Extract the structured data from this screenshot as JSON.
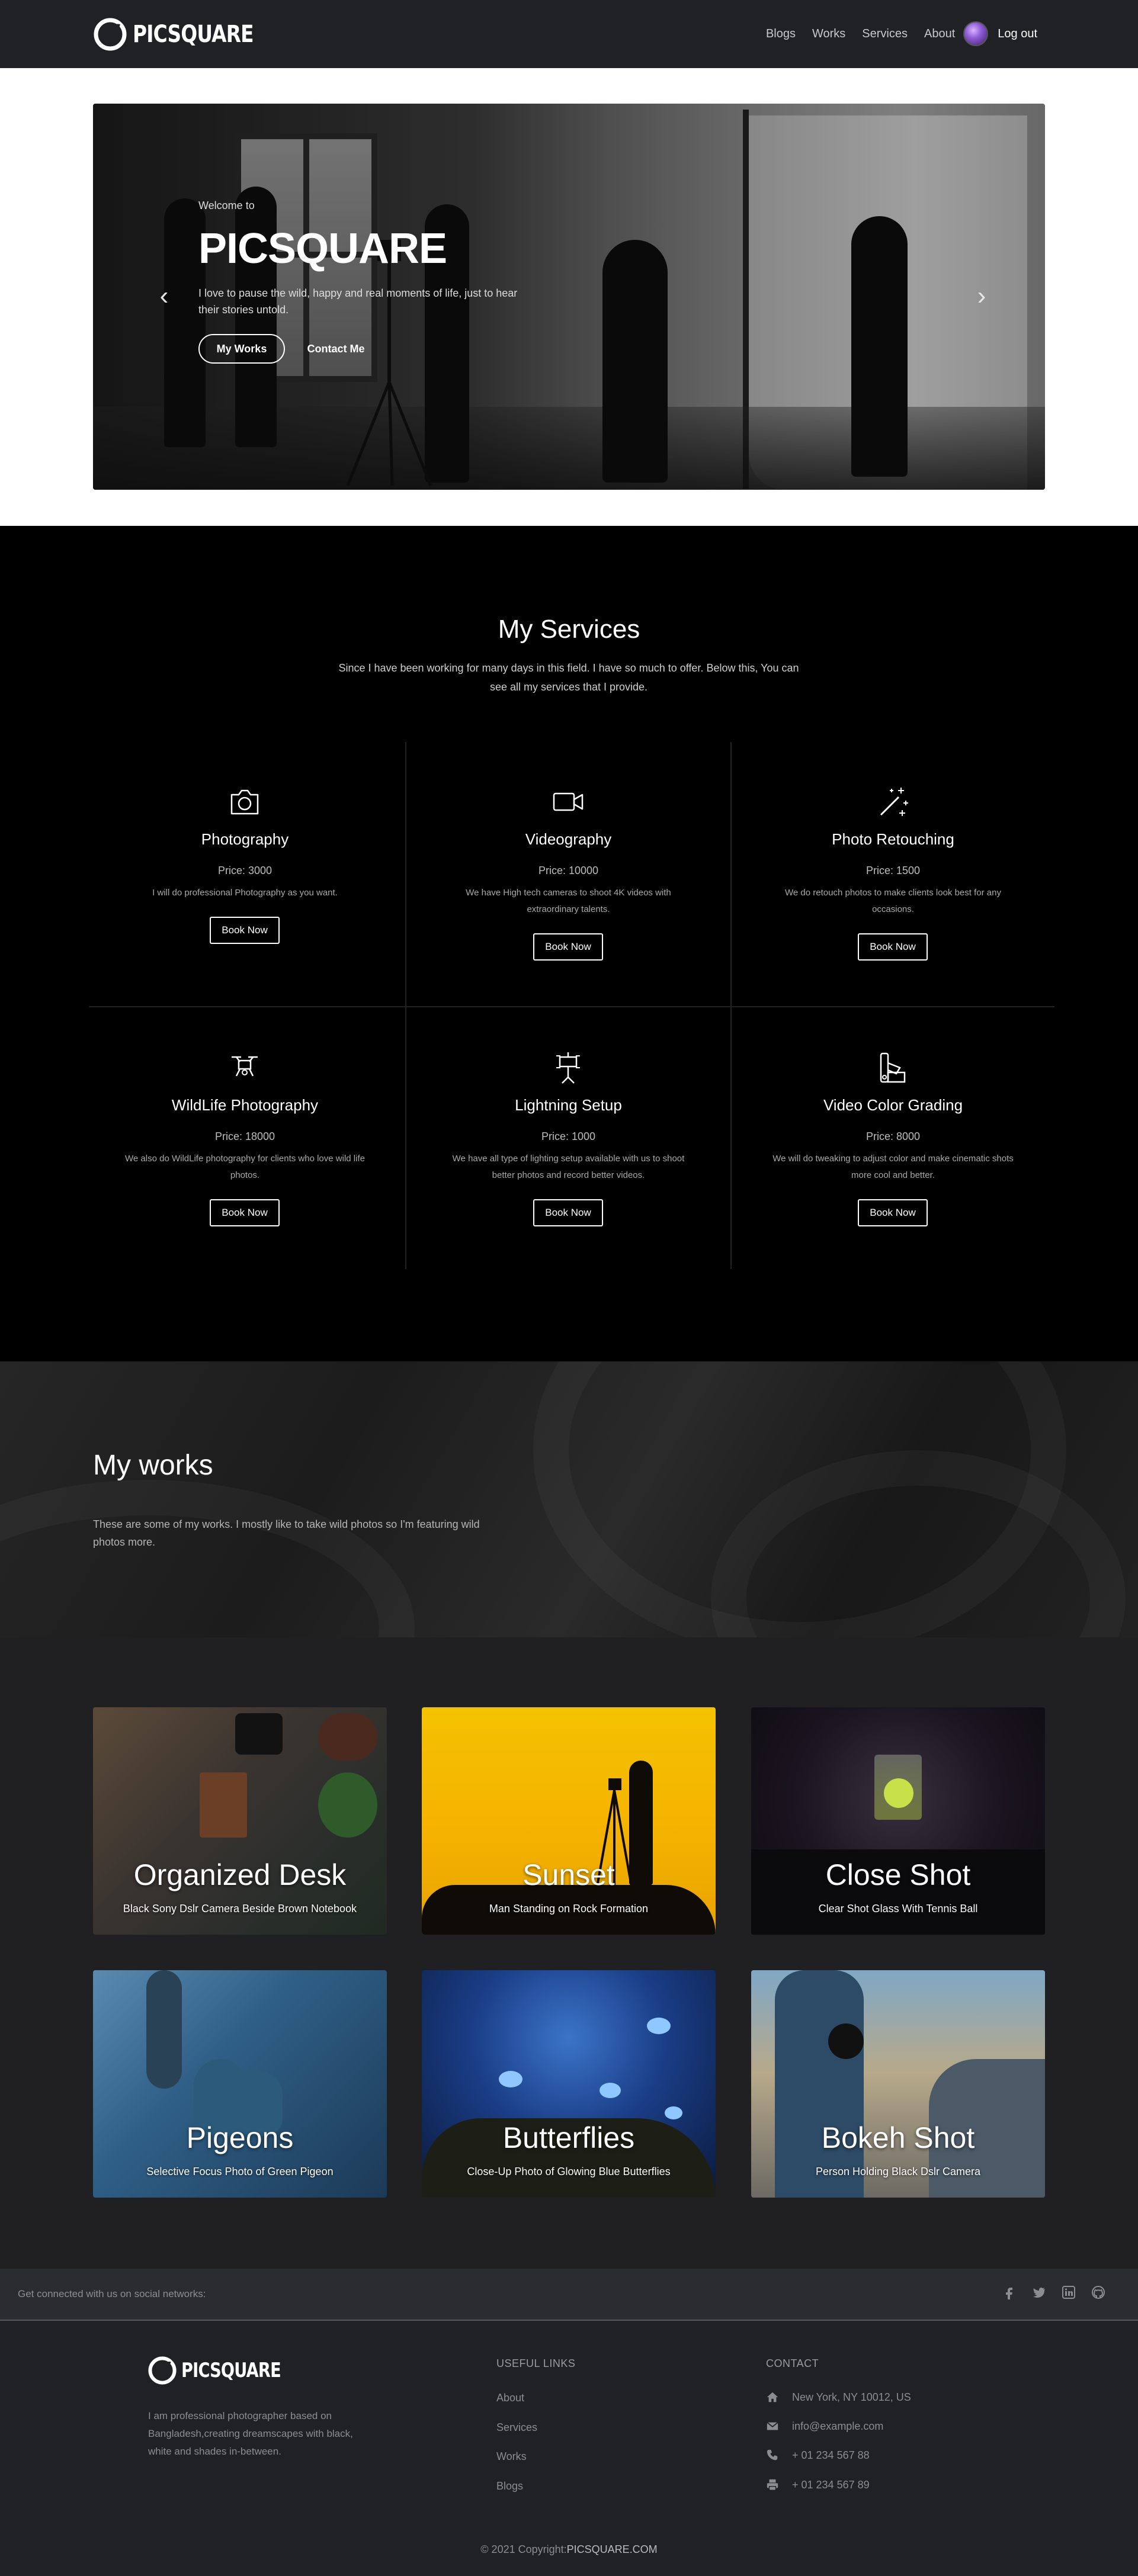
{
  "nav": {
    "brand": "PICSQUARE",
    "links": [
      "Blogs",
      "Works",
      "Services",
      "About"
    ],
    "logout": "Log out"
  },
  "hero": {
    "welcome": "Welcome to",
    "title": "PICSQUARE",
    "description": "I love to pause the wild, happy and real moments of life, just to hear their stories untold.",
    "primary_button": "My Works",
    "secondary_button": "Contact Me",
    "prev_icon": "chevron-left-icon",
    "next_icon": "chevron-right-icon"
  },
  "services": {
    "title": "My Services",
    "subtitle": "Since I have been working for many days in this field. I have so much to offer. Below this, You can see all my services that I provide.",
    "items": [
      {
        "name": "Photography",
        "price": "Price: 3000",
        "desc": "I will do professional Photography as you want.",
        "button": "Book Now",
        "icon": "camera-icon"
      },
      {
        "name": "Videography",
        "price": "Price: 10000",
        "desc": "We have High tech cameras to shoot 4K videos with extraordinary talents.",
        "button": "Book Now",
        "icon": "video-camera-icon"
      },
      {
        "name": "Photo Retouching",
        "price": "Price: 1500",
        "desc": "We do retouch photos to make clients look best for any occasions.",
        "button": "Book Now",
        "icon": "magic-wand-icon"
      },
      {
        "name": "WildLife Photography",
        "price": "Price: 18000",
        "desc": "We also do WildLife photography for clients who love wild life photos.",
        "button": "Book Now",
        "icon": "drone-icon"
      },
      {
        "name": "Lightning Setup",
        "price": "Price: 1000",
        "desc": "We have all type of lighting setup available with us to shoot better photos and record better videos.",
        "button": "Book Now",
        "icon": "studio-light-icon"
      },
      {
        "name": "Video Color Grading",
        "price": "Price: 8000",
        "desc": "We will do tweaking to adjust color and make cinematic shots more cool and better.",
        "button": "Book Now",
        "icon": "color-palette-icon"
      }
    ]
  },
  "works": {
    "title": "My works",
    "subtitle": "These are some of my works. I mostly like to take wild photos so I'm featuring wild photos more.",
    "cards": [
      {
        "title": "Organized Desk",
        "subtitle": "Black Sony Dslr Camera Beside Brown Notebook"
      },
      {
        "title": "Sunset",
        "subtitle": "Man Standing on Rock Formation"
      },
      {
        "title": "Close Shot",
        "subtitle": "Clear Shot Glass With Tennis Ball"
      },
      {
        "title": "Pigeons",
        "subtitle": "Selective Focus Photo of Green Pigeon"
      },
      {
        "title": "Butterflies",
        "subtitle": "Close-Up Photo of Glowing Blue Butterflies"
      },
      {
        "title": "Bokeh Shot",
        "subtitle": "Person Holding Black Dslr Camera"
      }
    ]
  },
  "social": {
    "text": "Get connected with us on social networks:",
    "icons": [
      "facebook-icon",
      "twitter-icon",
      "linkedin-icon",
      "github-icon"
    ]
  },
  "footer": {
    "brand": "PICSQUARE",
    "about": "I am professional photographer based on Bangladesh,creating dreamscapes with black, white and shades in-between.",
    "useful_links_title": "USEFUL LINKS",
    "useful_links": [
      "About",
      "Services",
      "Works",
      "Blogs"
    ],
    "contact_title": "CONTACT",
    "contact": {
      "address": "New York, NY 10012, US",
      "email": "info@example.com",
      "phone": "+ 01 234 567 88",
      "fax": "+ 01 234 567 89"
    },
    "copyright_prefix": "© 2021 Copyright:",
    "copyright_site": "PICSQUARE.COM"
  }
}
